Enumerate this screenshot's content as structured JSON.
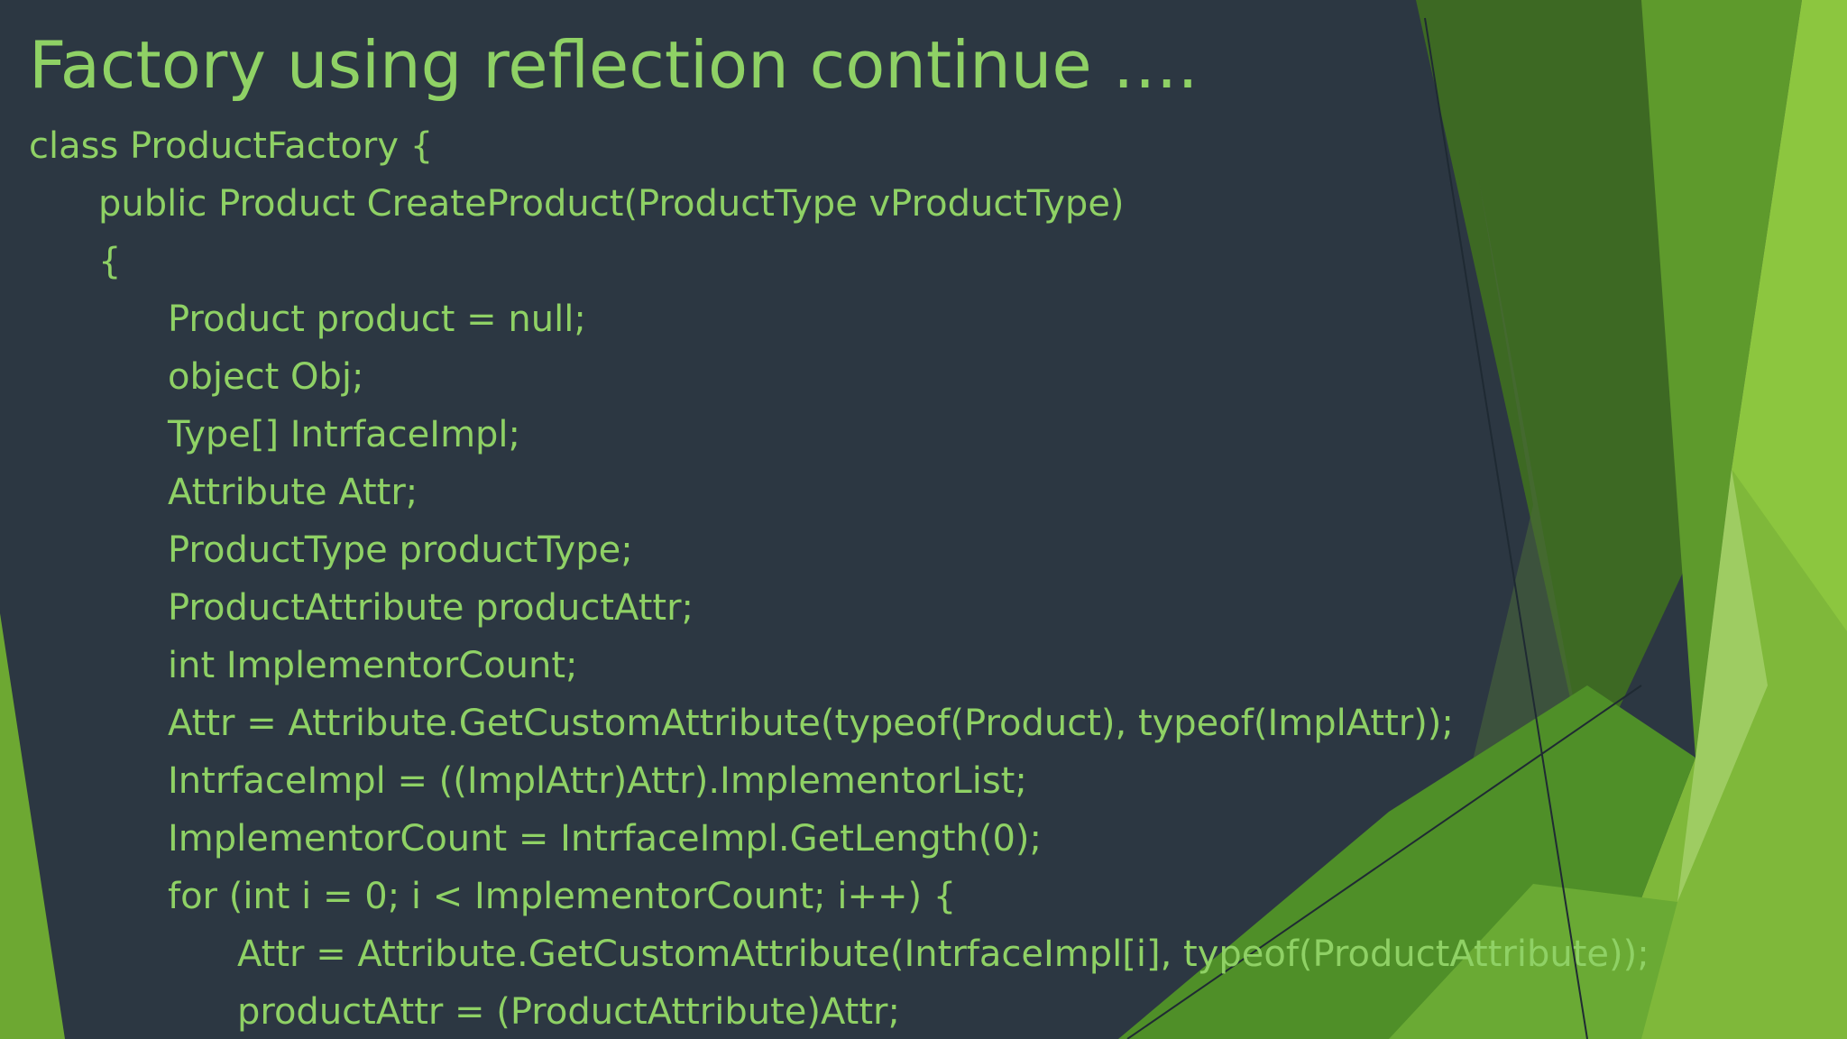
{
  "slide": {
    "title": "Factory using reflection continue ….",
    "code_lines": [
      {
        "text": "class ProductFactory {",
        "indent": 0
      },
      {
        "text": "public Product CreateProduct(ProductType vProductType)",
        "indent": 1
      },
      {
        "text": "{",
        "indent": 1
      },
      {
        "text": "Product product = null;",
        "indent": 2
      },
      {
        "text": "object Obj;",
        "indent": 2
      },
      {
        "text": "Type[] IntrfaceImpl;",
        "indent": 2
      },
      {
        "text": "Attribute Attr;",
        "indent": 2
      },
      {
        "text": "ProductType productType;",
        "indent": 2
      },
      {
        "text": "ProductAttribute productAttr;",
        "indent": 2
      },
      {
        "text": "int ImplementorCount;",
        "indent": 2
      },
      {
        "text": "Attr = Attribute.GetCustomAttribute(typeof(Product), typeof(ImplAttr));",
        "indent": 2
      },
      {
        "text": "IntrfaceImpl = ((ImplAttr)Attr).ImplementorList;",
        "indent": 2
      },
      {
        "text": "ImplementorCount = IntrfaceImpl.GetLength(0);",
        "indent": 2
      },
      {
        "text": "for (int i = 0; i < ImplementorCount; i++) {",
        "indent": 2
      },
      {
        "text": "Attr = Attribute.GetCustomAttribute(IntrfaceImpl[i], typeof(ProductAttribute));",
        "indent": 3
      },
      {
        "text": "productAttr = (ProductAttribute)Attr;",
        "indent": 3
      }
    ]
  },
  "colors": {
    "background": "#2c3742",
    "text": "#8fd165",
    "accent_light": "#8cc63f",
    "accent_mid": "#5a9e2e",
    "accent_dark": "#3e6b22"
  }
}
